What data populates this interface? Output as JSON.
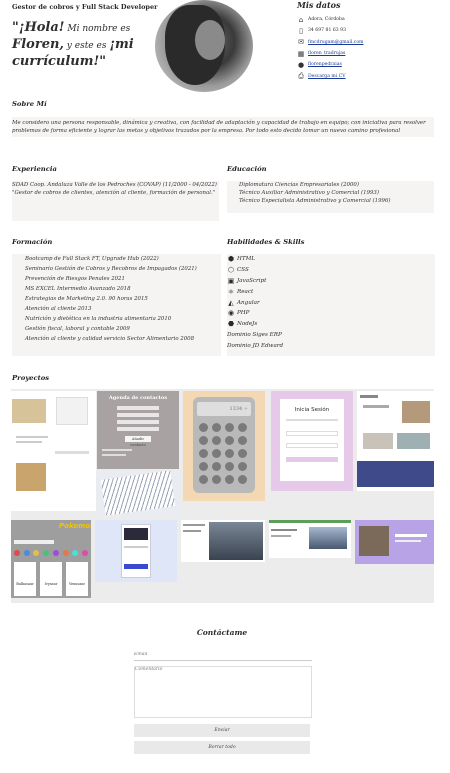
{
  "header": {
    "role": "Gestor de cobros y Full Stack Developer",
    "hello_big": "\"¡Hola!",
    "hello_small": " Mi nombre es",
    "hello_name": "Floren,",
    "hello_small2": " y este es ",
    "hello_cv": "¡mi currículum!\""
  },
  "contact": {
    "title": "Mis datos",
    "items": [
      {
        "icon": "home-icon",
        "glyph": "⌂",
        "text": "Adora, Córdoba",
        "link": false
      },
      {
        "icon": "phone-icon",
        "glyph": "▯",
        "text": "34 697 81 63 93",
        "link": false
      },
      {
        "icon": "mail-icon",
        "glyph": "✉",
        "text": "fmcdrugam@gmail.com",
        "link": true
      },
      {
        "icon": "linkedin-icon",
        "glyph": "▦",
        "text": "floren_tradrujas",
        "link": true
      },
      {
        "icon": "github-icon",
        "glyph": "●",
        "text": "florenpedraias",
        "link": true
      },
      {
        "icon": "download-icon",
        "glyph": "⎙",
        "text": "Descarga mi CV",
        "link": true
      }
    ]
  },
  "about": {
    "title": "Sobre Mí",
    "text": "Me considero una persona responsable, dinámica y creativa, con facilidad de adaptación y capacidad de trabajo en equipo; con iniciativa para resolver problemas de forma eficiente y lograr las metas y objetivos trazados por la empresa. Por todo esto decido tomar un nuevo camino profesional"
  },
  "experience": {
    "title": "Experiencia",
    "lines": [
      "SDAD Coop. Andaluza Valle de los Pedroches (COVAP) (11/2000 - 04/2022)",
      "\"Gestor de cobros de clientes, atención al cliente, formación de personal.\""
    ]
  },
  "education": {
    "title": "Educación",
    "lines": [
      "Diplomatura Ciencias Empresariales (2000)",
      "Técnico Auxiliar Administrativo y Comercial (1993)",
      "Técnico Especialista Administrativo y Comercial (1996)"
    ]
  },
  "training": {
    "title": "Formación",
    "lines": [
      "Bootcamp de Full Stack FT, Upgrade Hub (2022)",
      "Seminario Gestión de Cobros y Recobros de Impagados (2021)",
      "Prevención de Riesgos Penales  2021",
      "MS EXCEL Intermedio Avanzado  2018",
      "Estrategias de Marketing 2.0. 90 horas  2015",
      "Atención al cliente  2013",
      "Nutrición y dietética en la industria alimentaria  2010",
      "Gestión fiscal, laboral y contable  2009",
      "Atención al cliente y calidad servicio Sector Alimentario  2008"
    ]
  },
  "skills": {
    "title": "Habilidades & Skills",
    "items": [
      {
        "icon": "html5-icon",
        "glyph": "⬢",
        "label": "HTML"
      },
      {
        "icon": "css3-icon",
        "glyph": "⬡",
        "label": "CSS"
      },
      {
        "icon": "javascript-icon",
        "glyph": "▣",
        "label": "JavaScript"
      },
      {
        "icon": "react-icon",
        "glyph": "⚛",
        "label": "React"
      },
      {
        "icon": "angular-icon",
        "glyph": "◭",
        "label": "Angular"
      },
      {
        "icon": "php-icon",
        "glyph": "◉",
        "label": "PHP"
      },
      {
        "icon": "nodejs-icon",
        "glyph": "⬣",
        "label": "NodeJs"
      },
      {
        "icon": "",
        "glyph": "",
        "label": "Dominio Siges ERP"
      },
      {
        "icon": "",
        "glyph": "",
        "label": "Dominio JD Edward"
      }
    ]
  },
  "projects": {
    "title": "Proyectos",
    "agenda_title": "Agenda de contactos",
    "agenda_button": "Añadir contacto",
    "calc_display": "1334 ÷",
    "login_title": "Inicia Sesión",
    "pokedex_title": "Pokemon",
    "pokedex_cards": [
      "Bulbasaur",
      "Ivysaur",
      "Venusaur"
    ]
  },
  "contact_form": {
    "title": "Contáctame",
    "email_placeholder": "Email",
    "comment_placeholder": "Comentario",
    "send_label": "Enviar",
    "clear_label": "Borrar todo"
  },
  "colors": {
    "panel": "#f6f3f3",
    "projects_bg": "#ececec",
    "link": "#1a3a9a",
    "login_bg": "#e6c9e8",
    "calc_bg": "#f4d8b4"
  }
}
